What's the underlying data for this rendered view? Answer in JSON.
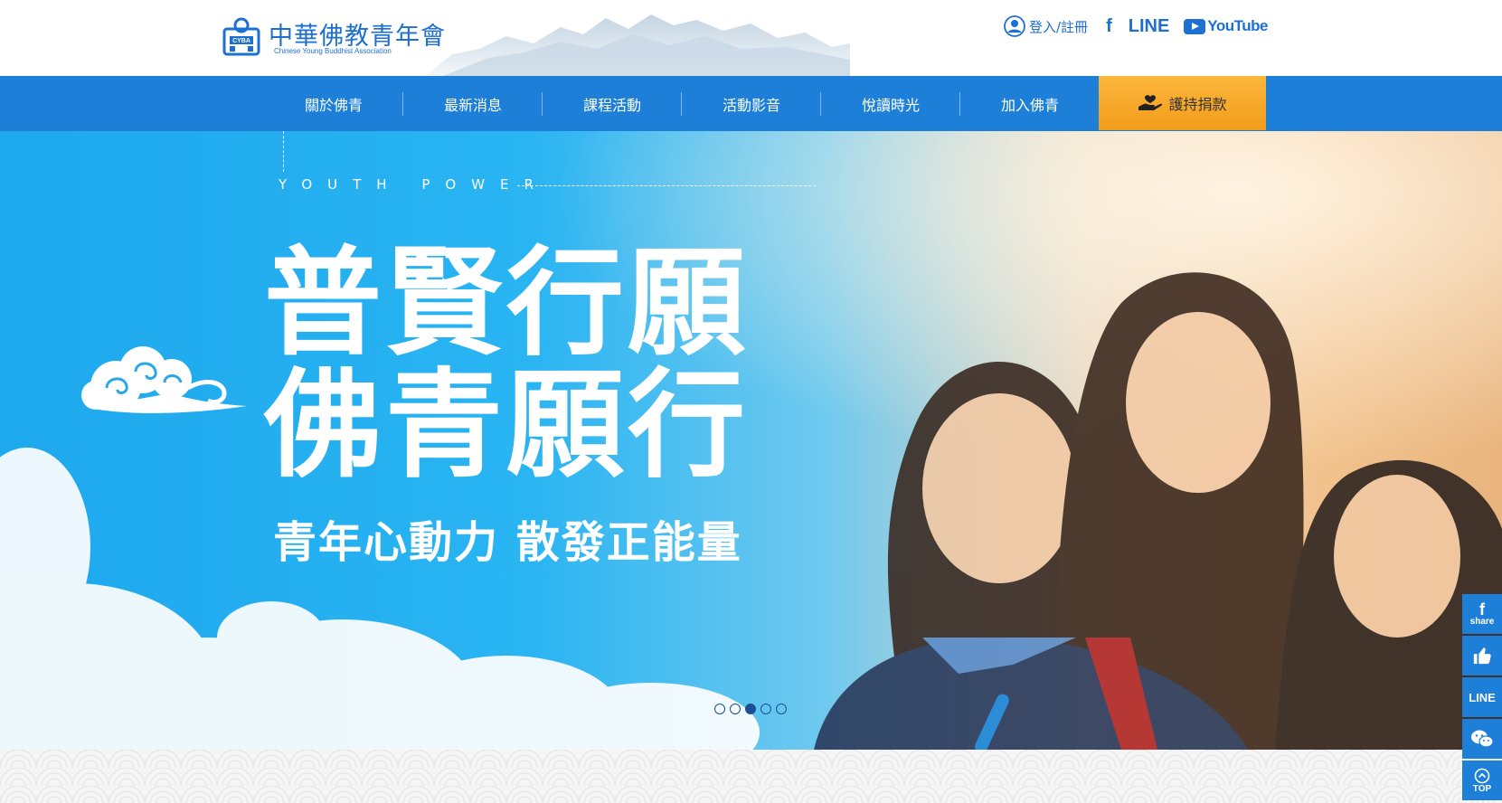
{
  "header": {
    "logo_cn": "中華佛教青年會",
    "logo_en": "Chinese Young Buddhist Association",
    "logo_badge": "CYBA",
    "login_label": "登入/註冊",
    "facebook_label": "f",
    "line_label": "LINE",
    "youtube_label": "YouTube"
  },
  "nav": {
    "items": [
      {
        "label": "關於佛青"
      },
      {
        "label": "最新消息"
      },
      {
        "label": "課程活動"
      },
      {
        "label": "活動影音"
      },
      {
        "label": "悅讀時光"
      },
      {
        "label": "加入佛青"
      }
    ],
    "donate_label": "護持捐款"
  },
  "hero": {
    "kicker": "YOUTH POWER",
    "headline_line1": "普賢行願",
    "headline_line2": "佛青願行",
    "tagline": "青年心動力 散發正能量",
    "carousel": {
      "total": 5,
      "active_index": 3
    }
  },
  "side_buttons": {
    "share_icon": "f",
    "share_label": "share",
    "like_icon": "thumbs-up-icon",
    "line_label": "LINE",
    "wechat_icon": "wechat-icon",
    "top_label": "TOP"
  },
  "colors": {
    "brand_blue": "#1d7fd8",
    "donate_orange": "#f8a82a",
    "dot_navy": "#1a4f96"
  }
}
